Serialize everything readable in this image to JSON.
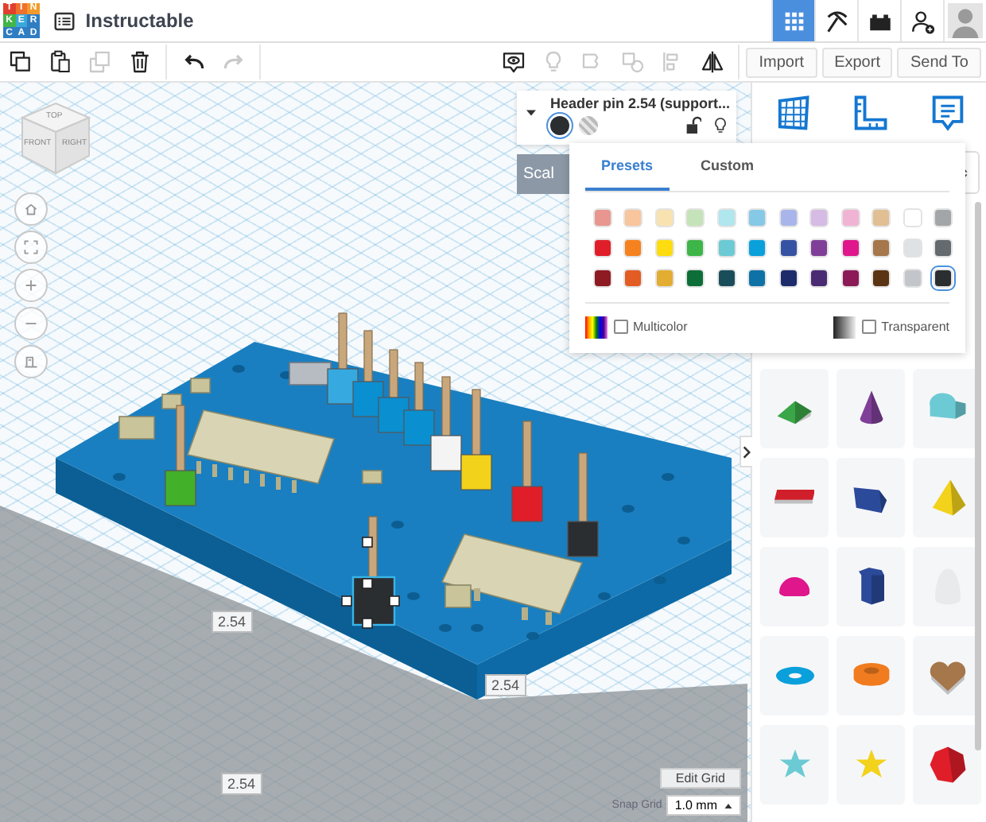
{
  "app": {
    "logo_letters": [
      "T",
      "I",
      "N",
      "K",
      "E",
      "R",
      "C",
      "A",
      "D"
    ],
    "project_title": "Instructable"
  },
  "nav_icons": [
    {
      "kind": "grid",
      "selected": true
    },
    {
      "kind": "pickaxe",
      "selected": false
    },
    {
      "kind": "bricks",
      "selected": false
    },
    {
      "kind": "add-user",
      "selected": false
    },
    {
      "kind": "avatar",
      "selected": false
    }
  ],
  "toolbar": {
    "edit_tools": [
      {
        "kind": "copy",
        "disabled": false
      },
      {
        "kind": "paste",
        "disabled": false
      },
      {
        "kind": "duplicate",
        "disabled": true
      },
      {
        "kind": "delete",
        "disabled": false
      }
    ],
    "history_tools": [
      {
        "kind": "undo",
        "disabled": false
      },
      {
        "kind": "redo",
        "disabled": true
      }
    ],
    "view_tools": [
      {
        "kind": "notes-toggle",
        "disabled": false
      },
      {
        "kind": "bulb",
        "disabled": true
      },
      {
        "kind": "group",
        "disabled": true
      },
      {
        "kind": "ungroup",
        "disabled": true
      },
      {
        "kind": "align",
        "disabled": true
      },
      {
        "kind": "mirror",
        "disabled": false
      }
    ],
    "buttons": [
      "Import",
      "Export",
      "Send To"
    ]
  },
  "view_cube": {
    "faces": [
      "TOP",
      "FRONT",
      "RIGHT"
    ]
  },
  "view_controls": [
    {
      "kind": "home"
    },
    {
      "kind": "fit"
    },
    {
      "kind": "zoom-in"
    },
    {
      "kind": "zoom-out"
    },
    {
      "kind": "ortho"
    }
  ],
  "inspector": {
    "title": "Header pin 2.54 (support...",
    "fill": [
      {
        "kind": "solid",
        "selected": true
      },
      {
        "kind": "hole",
        "selected": false
      }
    ],
    "locked": false,
    "scaling_label": "Scal"
  },
  "color_picker": {
    "tabs": [
      {
        "label": "Presets",
        "selected": true
      },
      {
        "label": "Custom",
        "selected": false
      }
    ],
    "swatches": [
      {
        "color": "#e8968f",
        "selected": false
      },
      {
        "color": "#f8c59c",
        "selected": false
      },
      {
        "color": "#f8e2b0",
        "selected": false
      },
      {
        "color": "#c5e3b8",
        "selected": false
      },
      {
        "color": "#b0e6ee",
        "selected": false
      },
      {
        "color": "#85c9e6",
        "selected": false
      },
      {
        "color": "#a9b5ea",
        "selected": false
      },
      {
        "color": "#d6bbe5",
        "selected": false
      },
      {
        "color": "#f1b3d3",
        "selected": false
      },
      {
        "color": "#e1bf93",
        "selected": false
      },
      {
        "color": "#ffffff",
        "selected": false
      },
      {
        "color": "#a3a6a8",
        "selected": false
      },
      {
        "color": "#e01e2a",
        "selected": false
      },
      {
        "color": "#f5821f",
        "selected": false
      },
      {
        "color": "#fddc10",
        "selected": false
      },
      {
        "color": "#3eb549",
        "selected": false
      },
      {
        "color": "#6ccad4",
        "selected": false
      },
      {
        "color": "#0aa0db",
        "selected": false
      },
      {
        "color": "#3653a3",
        "selected": false
      },
      {
        "color": "#7f3f98",
        "selected": false
      },
      {
        "color": "#df168c",
        "selected": false
      },
      {
        "color": "#a5774a",
        "selected": false
      },
      {
        "color": "#dfe2e5",
        "selected": false
      },
      {
        "color": "#646a6e",
        "selected": false
      },
      {
        "color": "#8e1a22",
        "selected": false
      },
      {
        "color": "#e25c23",
        "selected": false
      },
      {
        "color": "#e3ad32",
        "selected": false
      },
      {
        "color": "#0d6e38",
        "selected": false
      },
      {
        "color": "#1a4d5a",
        "selected": false
      },
      {
        "color": "#0f72a6",
        "selected": false
      },
      {
        "color": "#1d2b6b",
        "selected": false
      },
      {
        "color": "#4b2a74",
        "selected": false
      },
      {
        "color": "#8b1a57",
        "selected": false
      },
      {
        "color": "#5a3413",
        "selected": false
      },
      {
        "color": "#c2c6ca",
        "selected": false
      },
      {
        "color": "#2b2e31",
        "selected": true
      }
    ],
    "multicolor": {
      "label": "Multicolor",
      "checked": false
    },
    "transparent": {
      "label": "Transparent",
      "checked": false
    }
  },
  "shapes_panel": {
    "tools": [
      {
        "kind": "workplane"
      },
      {
        "kind": "ruler"
      },
      {
        "kind": "notes"
      }
    ],
    "shapes": [
      {
        "kind": "wedge",
        "color": "#3aa647"
      },
      {
        "kind": "cone",
        "color": "#7f3f98"
      },
      {
        "kind": "roof",
        "color": "#6ccad4"
      },
      {
        "kind": "text",
        "color": "#d01f2a"
      },
      {
        "kind": "polygon",
        "color": "#2c4a9a"
      },
      {
        "kind": "pyramid",
        "color": "#f2d21b"
      },
      {
        "kind": "hemisphere",
        "color": "#df168c"
      },
      {
        "kind": "prism",
        "color": "#2c4a9a"
      },
      {
        "kind": "paraboloid",
        "color": "#e8eaec"
      },
      {
        "kind": "torus",
        "color": "#0aa0db"
      },
      {
        "kind": "tube",
        "color": "#f07c1f"
      },
      {
        "kind": "heart",
        "color": "#a5774a"
      },
      {
        "kind": "star",
        "color": "#6ccad4"
      },
      {
        "kind": "star",
        "color": "#f2d21b"
      },
      {
        "kind": "icosahedron",
        "color": "#e01e2a"
      }
    ]
  },
  "dimension_labels": [
    "2.54",
    "2.54",
    "2.54"
  ],
  "grid": {
    "edit_button": "Edit Grid",
    "snap_label": "Snap Grid",
    "snap_value": "1.0 mm"
  }
}
